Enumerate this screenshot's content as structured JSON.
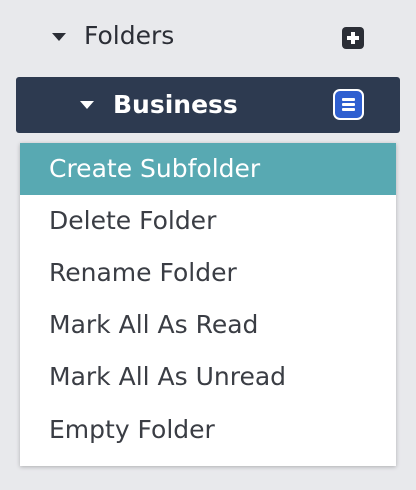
{
  "sidebar": {
    "folders_label": "Folders",
    "current_folder": "Business"
  },
  "context_menu": {
    "items": [
      {
        "label": "Create Subfolder",
        "highlighted": true
      },
      {
        "label": "Delete Folder",
        "highlighted": false
      },
      {
        "label": "Rename Folder",
        "highlighted": false
      },
      {
        "label": "Mark All As Read",
        "highlighted": false
      },
      {
        "label": "Mark All As Unread",
        "highlighted": false
      },
      {
        "label": "Empty Folder",
        "highlighted": false
      }
    ]
  },
  "colors": {
    "background": "#e8e9ec",
    "folder_row": "#2d3a50",
    "highlight": "#58a9b2",
    "menu_icon": "#2f5fd0",
    "text_dark": "#2b2e36"
  },
  "icons": {
    "folders_toggle": "caret-down-icon",
    "add_folder": "plus-square-icon",
    "folder_toggle": "caret-down-icon",
    "folder_menu": "hamburger-menu-icon"
  }
}
